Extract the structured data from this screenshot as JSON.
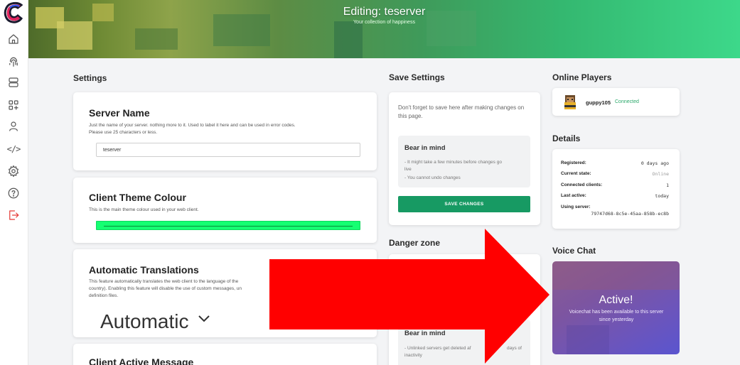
{
  "header": {
    "title": "Editing: teserver",
    "subtitle": "Your collection of happiness"
  },
  "sidebar": {
    "items": [
      {
        "icon": "home-icon"
      },
      {
        "icon": "fingerprint-icon"
      },
      {
        "icon": "server-icon"
      },
      {
        "icon": "apps-add-icon"
      },
      {
        "icon": "user-icon"
      },
      {
        "icon": "code-icon",
        "glyph": "</>"
      },
      {
        "icon": "gear-icon"
      },
      {
        "icon": "help-icon"
      },
      {
        "icon": "logout-icon"
      }
    ]
  },
  "settings": {
    "title": "Settings",
    "server_name": {
      "heading": "Server Name",
      "description_1": "Just the name of your server. nothing more to it. Used to label it here and can be used in error codes.",
      "description_2": "Please use 25 characters or less.",
      "value": "teserver"
    },
    "theme_colour": {
      "heading": "Client Theme Colour",
      "description": "This is the main theme colour used in your web client.",
      "color": "#15ff72"
    },
    "translations": {
      "heading": "Automatic Translations",
      "description_1": "This feature automatically translates the web client to the language of the",
      "description_2": "country). Enabling this feature will disable the use of custom messages, un",
      "description_3": "definition files.",
      "selected": "Automatic"
    },
    "active_message": {
      "heading": "Client Active Message"
    }
  },
  "save_settings": {
    "title": "Save Settings",
    "text": "Don't forget to save here after making changes on this page.",
    "bear_title": "Bear in mind",
    "bear_line_1": "- It might take a few minutes before changes go",
    "bear_line_2": "live",
    "bear_line_3": "- You cannot undo changes",
    "button": "SAVE CHANGES"
  },
  "danger_zone": {
    "title": "Danger zone",
    "bear_title": "Bear in mind",
    "bear_line_1": "- Unlinked servers get deleted af",
    "bear_line_1b": "days of",
    "bear_line_2": "inactivity"
  },
  "online_players": {
    "title": "Online Players",
    "players": [
      {
        "name": "guppy105",
        "status": "Connected"
      }
    ]
  },
  "details": {
    "title": "Details",
    "rows": [
      {
        "label": "Registered:",
        "value": "0 days ago"
      },
      {
        "label": "Current state:",
        "value": "Online"
      },
      {
        "label": "Connected clients:",
        "value": "1"
      },
      {
        "label": "Last active:",
        "value": "today"
      }
    ],
    "server_label": "Using server:",
    "server_id": "79747d68-8c5e-45aa-858b-ec8b"
  },
  "voice_chat": {
    "title": "Voice Chat",
    "status": "Active!",
    "text": "Voicechat has been available to this server since yesterday"
  },
  "colors": {
    "accent_green": "#179a63",
    "status_green": "#2aa86a",
    "logout_red": "#e53935",
    "overlay_arrow": "#ff0000"
  }
}
